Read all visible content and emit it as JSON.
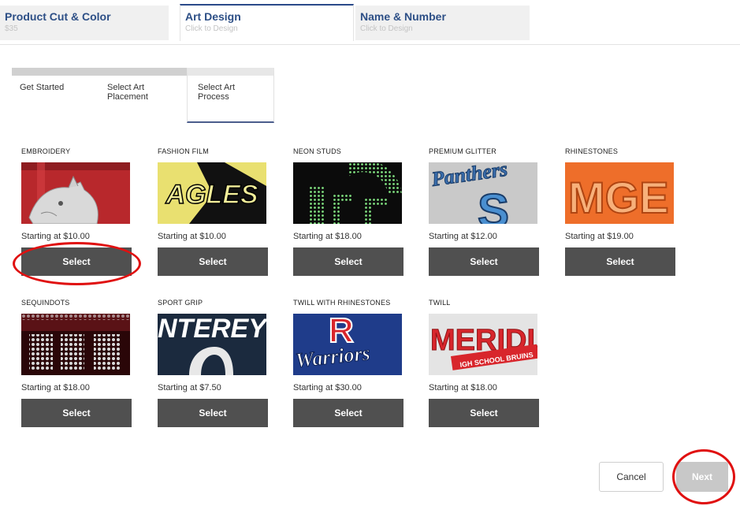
{
  "top_tabs": [
    {
      "title": "Product Cut & Color",
      "sub": "$35"
    },
    {
      "title": "Art Design",
      "sub": "Click to Design"
    },
    {
      "title": "Name & Number",
      "sub": "Click to Design"
    }
  ],
  "steps": [
    {
      "label": "Get Started"
    },
    {
      "label": "Select Art Placement"
    },
    {
      "label": "Select Art Process"
    }
  ],
  "processes": [
    {
      "name": "EMBROIDERY",
      "price": "Starting at $10.00",
      "button": "Select"
    },
    {
      "name": "FASHION FILM",
      "price": "Starting at $10.00",
      "button": "Select"
    },
    {
      "name": "NEON STUDS",
      "price": "Starting at $18.00",
      "button": "Select"
    },
    {
      "name": "PREMIUM GLITTER",
      "price": "Starting at $12.00",
      "button": "Select"
    },
    {
      "name": "RHINESTONES",
      "price": "Starting at $19.00",
      "button": "Select"
    },
    {
      "name": "SEQUINDOTS",
      "price": "Starting at $18.00",
      "button": "Select"
    },
    {
      "name": "SPORT GRIP",
      "price": "Starting at $7.50",
      "button": "Select"
    },
    {
      "name": "TWILL WITH RHINESTONES",
      "price": "Starting at $30.00",
      "button": "Select"
    },
    {
      "name": "TWILL",
      "price": "Starting at $18.00",
      "button": "Select"
    }
  ],
  "sample_art": {
    "fashion_film": "AGLES",
    "premium_glitter": "Panthers",
    "premium_glitter_letter": "S",
    "rhinestones": "MGE",
    "sport_grip": "NTEREY",
    "twill_rhinestones": "Warriors",
    "twill_rhinestones_letter": "R",
    "twill": "MERIDIA",
    "twill_sub": "IGH SCHOOL BRUINS"
  },
  "footer": {
    "cancel": "Cancel",
    "next": "Next"
  },
  "colors": {
    "accent_blue": "#2d4f86",
    "button_dark": "#505050",
    "highlight_red": "#e01010"
  }
}
